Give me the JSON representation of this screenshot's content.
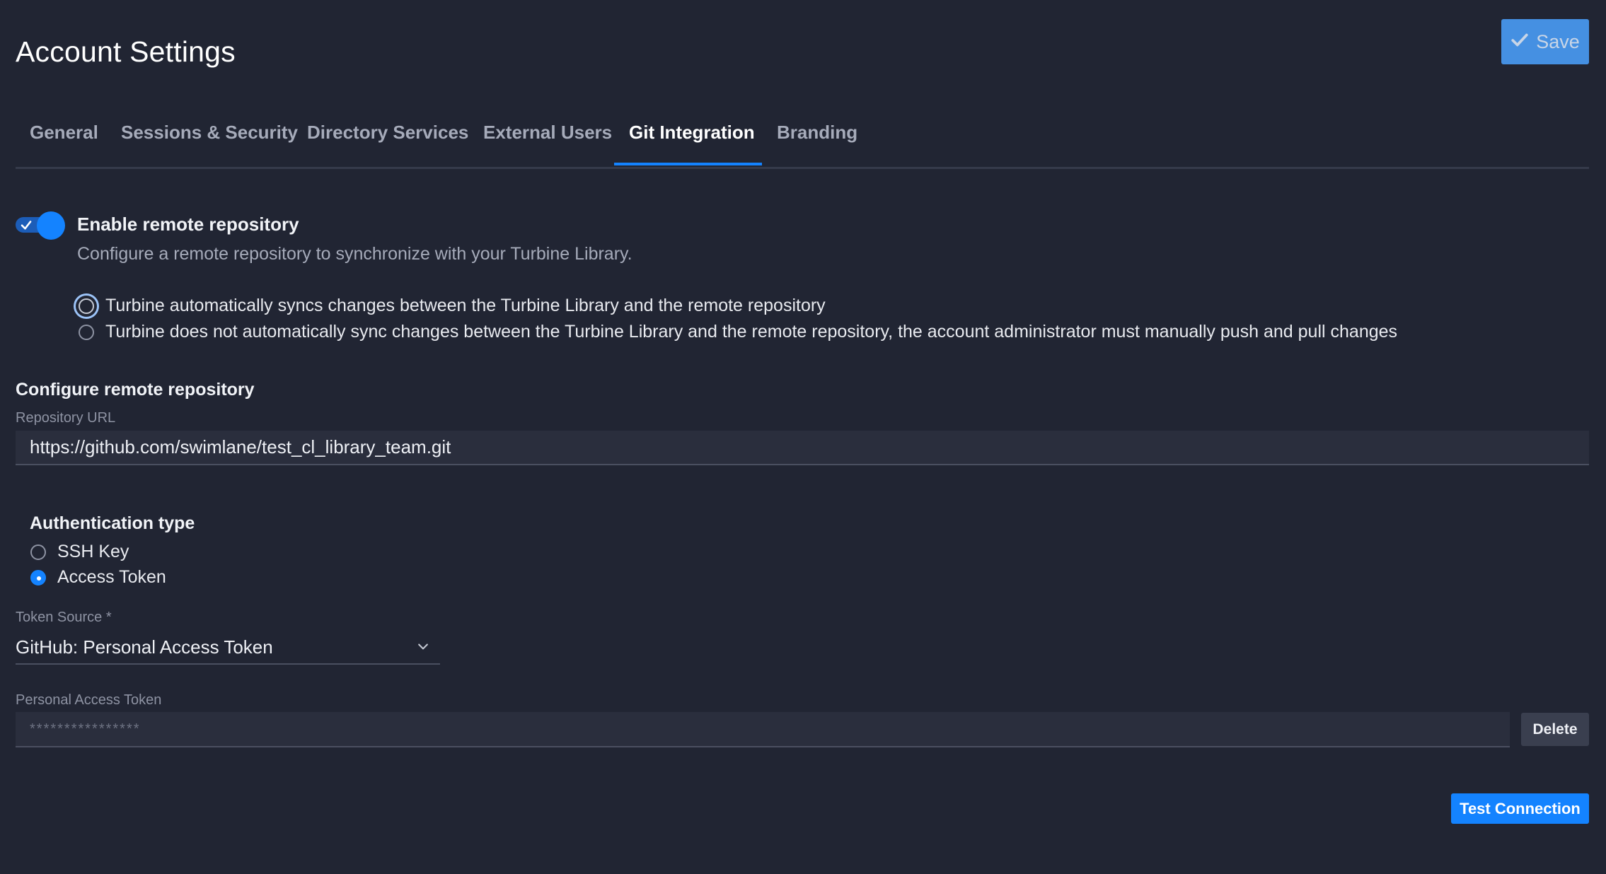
{
  "page": {
    "title": "Account Settings"
  },
  "toolbar": {
    "save_label": "Save"
  },
  "tabs": [
    {
      "label": "General",
      "active": false
    },
    {
      "label": "Sessions & Security",
      "active": false
    },
    {
      "label": "Directory Services",
      "active": false
    },
    {
      "label": "External Users",
      "active": false
    },
    {
      "label": "Git Integration",
      "active": true
    },
    {
      "label": "Branding",
      "active": false
    }
  ],
  "remote_repository": {
    "enabled": true,
    "label": "Enable remote repository",
    "description": "Configure a remote repository to synchronize with your Turbine Library.",
    "sync_options": [
      {
        "label": "Turbine automatically syncs changes between the Turbine Library and the remote repository",
        "selected": false,
        "focused": true
      },
      {
        "label": "Turbine does not automatically sync changes between the Turbine Library and the remote repository, the account administrator must manually push and pull changes",
        "selected": false,
        "focused": false
      }
    ]
  },
  "configure": {
    "title": "Configure remote repository",
    "repository_url_label": "Repository URL",
    "repository_url_value": "https://github.com/swimlane/test_cl_library_team.git"
  },
  "authentication": {
    "title": "Authentication type",
    "options": [
      {
        "label": "SSH Key",
        "selected": false
      },
      {
        "label": "Access Token",
        "selected": true
      }
    ]
  },
  "token_source": {
    "label": "Token Source *",
    "value": "GitHub: Personal Access Token"
  },
  "personal_access_token": {
    "label": "Personal Access Token",
    "placeholder": "****************",
    "delete_label": "Delete"
  },
  "actions": {
    "test_connection_label": "Test Connection"
  },
  "colors": {
    "background": "#212533",
    "accent": "#1483ff",
    "save_button": "#4a9cf5",
    "muted_text": "#a6abba"
  },
  "icons": {
    "save": "check-icon",
    "toggle": "check-icon",
    "select": "chevron-down-icon"
  }
}
